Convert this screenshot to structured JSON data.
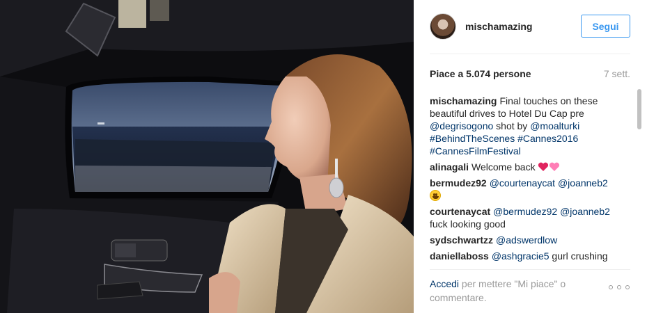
{
  "header": {
    "username": "mischamazing",
    "follow_label": "Segui"
  },
  "stats": {
    "likes_text": "Piace a 5.074 persone",
    "time_ago": "7 sett."
  },
  "comments": [
    {
      "author": "mischamazing",
      "parts": [
        {
          "text": "Final touches on these beautiful drives to Hotel Du Cap pre ",
          "link": false
        },
        {
          "text": "@degrisogono",
          "link": true
        },
        {
          "text": " shot by ",
          "link": false
        },
        {
          "text": "@moalturki",
          "link": true
        },
        {
          "text": " ",
          "link": false
        },
        {
          "text": "#BehindTheScenes",
          "link": true
        },
        {
          "text": " ",
          "link": false
        },
        {
          "text": "#Cannes2016",
          "link": true
        },
        {
          "text": " ",
          "link": false
        },
        {
          "text": "#CannesFilmFestival",
          "link": true
        }
      ]
    },
    {
      "author": "alinagali",
      "parts": [
        {
          "text": "Welcome back ",
          "link": false
        },
        {
          "emoji": "red-heart"
        },
        {
          "emoji": "pink-heart"
        }
      ]
    },
    {
      "author": "bermudez92",
      "parts": [
        {
          "text": "@courtenaycat",
          "link": true
        },
        {
          "text": " ",
          "link": false
        },
        {
          "text": "@joanneb2",
          "link": true
        },
        {
          "text": " ",
          "link": false
        },
        {
          "emoji": "smiley"
        }
      ]
    },
    {
      "author": "courtenaycat",
      "parts": [
        {
          "text": "@bermudez92",
          "link": true
        },
        {
          "text": " ",
          "link": false
        },
        {
          "text": "@joanneb2",
          "link": true
        },
        {
          "text": " fuck looking good",
          "link": false
        }
      ]
    },
    {
      "author": "sydschwartzz",
      "parts": [
        {
          "text": "@adswerdlow",
          "link": true
        }
      ]
    },
    {
      "author": "daniellaboss",
      "parts": [
        {
          "text": "@ashgracie5",
          "link": true
        },
        {
          "text": " gurl crushing",
          "link": false
        }
      ]
    }
  ],
  "footer": {
    "login_label": "Accedi",
    "rest_text": " per mettere \"Mi piace\" o commentare."
  },
  "icons": {
    "more": "more-options-icon",
    "heart": "heart-emoji-icon",
    "smiley": "smiley-emoji-icon"
  },
  "colors": {
    "link": "#003569",
    "accent": "#3897f0",
    "muted": "#999999",
    "text": "#262626",
    "red_heart": "#e0245e",
    "pink_heart": "#ff7eb6"
  }
}
